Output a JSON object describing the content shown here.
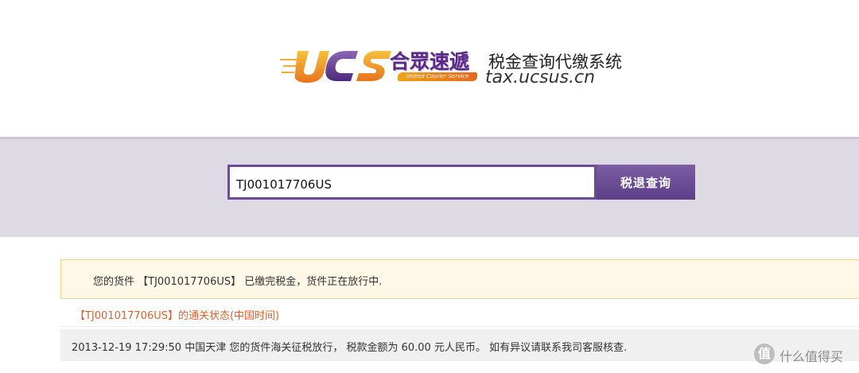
{
  "header": {
    "logo_cn": "合眾速遞",
    "logo_en": "United Courier Service",
    "logo_sub": "税金查询代缴系统",
    "logo_url": "tax.ucsus.cn",
    "logo_letters": "UCS"
  },
  "search": {
    "value": "TJ001017706US",
    "button_label": "税退查询"
  },
  "notice": {
    "text": "您的货件 【TJ001017706US】 已缴完税金，货件正在放行中."
  },
  "status": {
    "title": "【TJ001017706US】的通关状态(中国时间)",
    "record": "2013-12-19 17:29:50 中国天津 您的货件海关征税放行， 税款金额为 60.00 元人民币。 如有异议请联系我司客服核查."
  },
  "watermark": {
    "icon_char": "值",
    "text": "什么值得买"
  },
  "colors": {
    "brand_purple": "#5d3f88",
    "band_bg": "#dedae3",
    "notice_bg": "#fef8e7",
    "notice_border": "#f3d589",
    "status_orange": "#e0602c"
  }
}
